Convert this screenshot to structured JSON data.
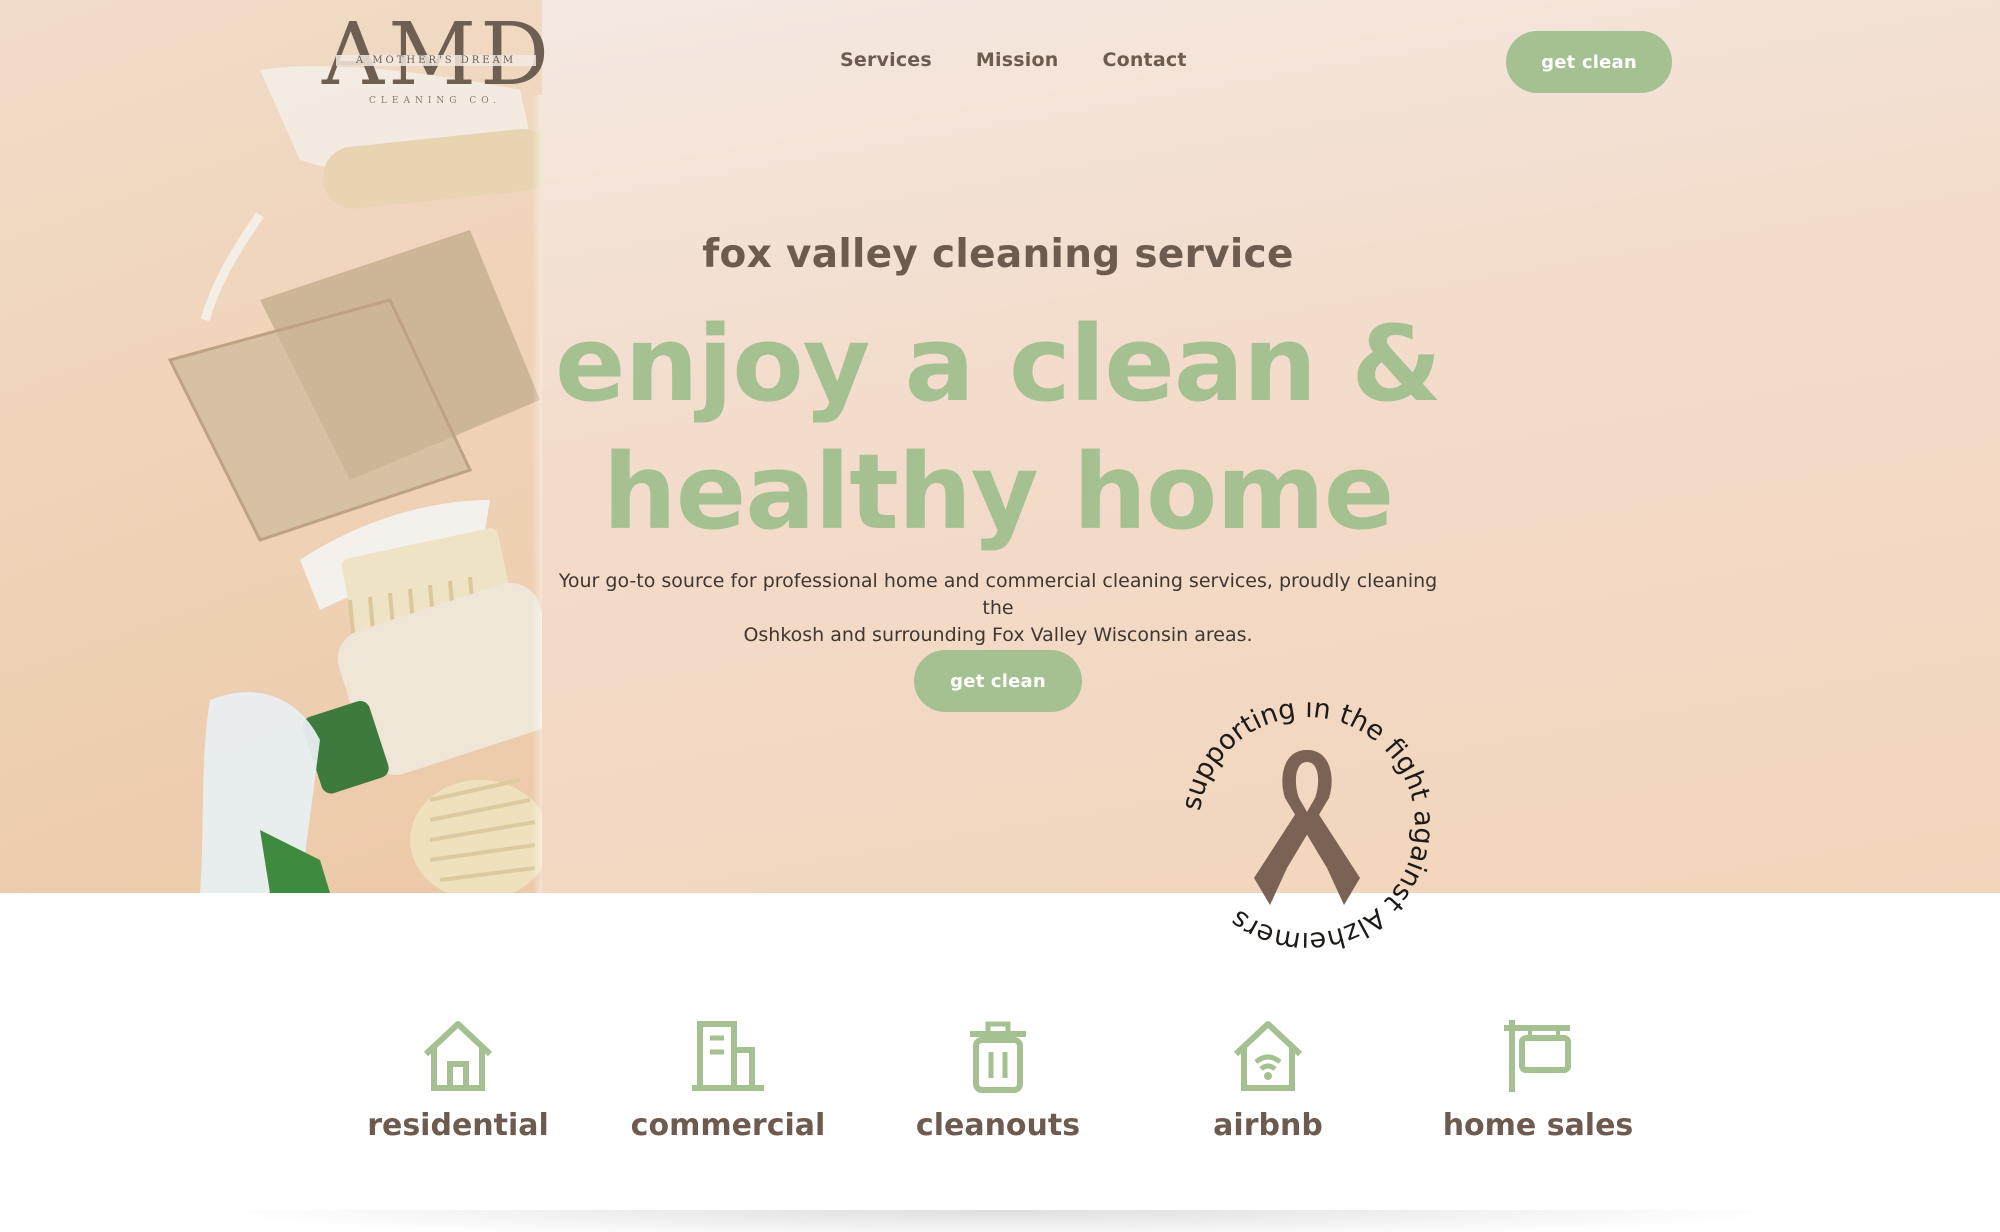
{
  "colors": {
    "accent_green": "#a5c192",
    "brown_text": "#6e5b4f",
    "hero_bg": "#f2d9c4"
  },
  "logo": {
    "main": "AMD",
    "tagline": "A MOTHER'S DREAM",
    "sub": "CLEANING CO."
  },
  "nav": {
    "items": [
      {
        "label": "Services"
      },
      {
        "label": "Mission"
      },
      {
        "label": "Contact"
      }
    ],
    "cta": "get clean"
  },
  "hero": {
    "kicker": "fox valley cleaning service",
    "headline_line1": "enjoy a clean &",
    "headline_line2": "healthy home",
    "description_line1": "Your go-to source for professional home and commercial cleaning services, proudly cleaning the",
    "description_line2": "Oshkosh and surrounding Fox Valley Wisconsin areas.",
    "cta": "get clean"
  },
  "badge": {
    "text": "supporting in the fight against Alzheimers",
    "icon": "ribbon-icon"
  },
  "services": [
    {
      "label": "residential",
      "icon": "house-icon"
    },
    {
      "label": "commercial",
      "icon": "building-icon"
    },
    {
      "label": "cleanouts",
      "icon": "trash-can-icon"
    },
    {
      "label": "airbnb",
      "icon": "house-wifi-icon"
    },
    {
      "label": "home sales",
      "icon": "sign-post-icon"
    }
  ]
}
